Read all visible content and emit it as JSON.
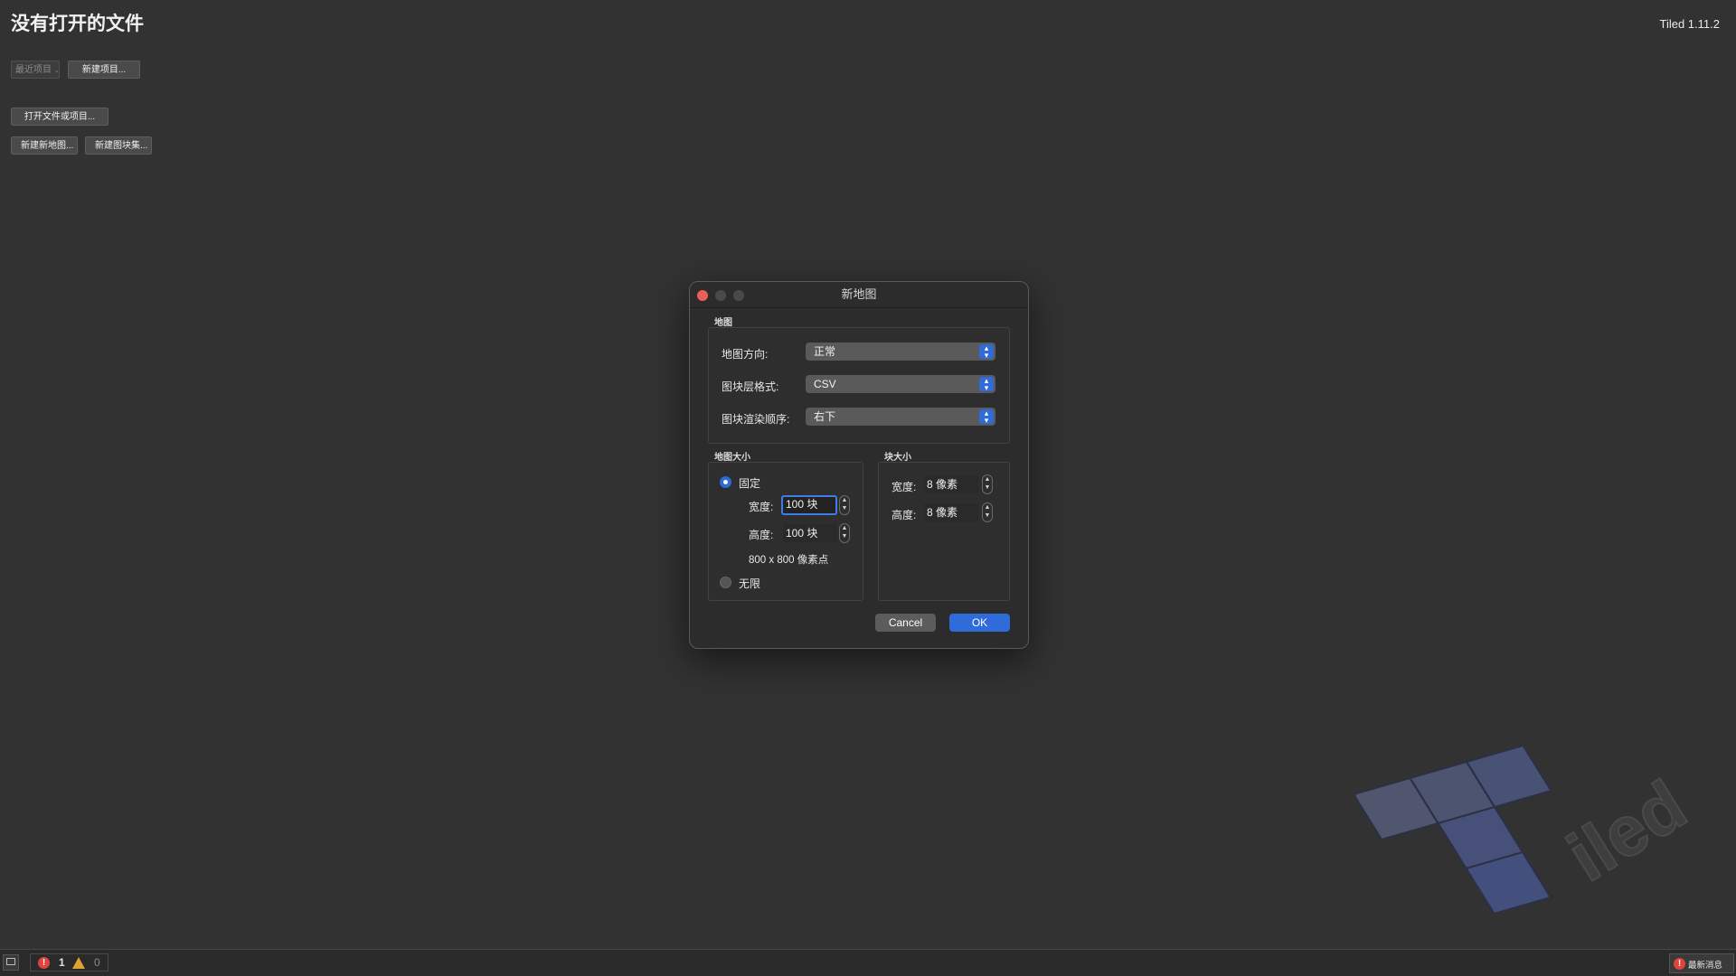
{
  "window": {
    "title": "没有打开的文件",
    "version": "Tiled 1.11.2"
  },
  "start": {
    "recent_projects": "最近项目",
    "new_project": "新建项目...",
    "open_file_or_project": "打开文件或项目...",
    "new_map": "新建新地图...",
    "new_tileset": "新建图块集..."
  },
  "dialog": {
    "title": "新地图",
    "map_section": "地图",
    "orientation_label": "地图方向:",
    "orientation_value": "正常",
    "layer_format_label": "图块层格式:",
    "layer_format_value": "CSV",
    "render_order_label": "图块渲染顺序:",
    "render_order_value": "右下",
    "map_size_section": "地图大小",
    "fixed_label": "固定",
    "width_label": "宽度:",
    "width_value": "100 块",
    "height_label": "高度:",
    "height_value": "100 块",
    "pixel_size": "800 x 800 像素点",
    "infinite_label": "无限",
    "tile_size_section": "块大小",
    "tile_width_label": "宽度:",
    "tile_width_value": "8 像素",
    "tile_height_label": "高度:",
    "tile_height_value": "8 像素",
    "cancel": "Cancel",
    "ok": "OK"
  },
  "statusbar": {
    "error_count": "1",
    "warning_count": "0",
    "news": "最新消息"
  },
  "colors": {
    "background": "#323232",
    "accent": "#2f6bd9",
    "close_light": "#ec5f58",
    "error": "#e0443e",
    "warning": "#d9a431"
  },
  "watermark": {
    "text": "Tiled"
  }
}
